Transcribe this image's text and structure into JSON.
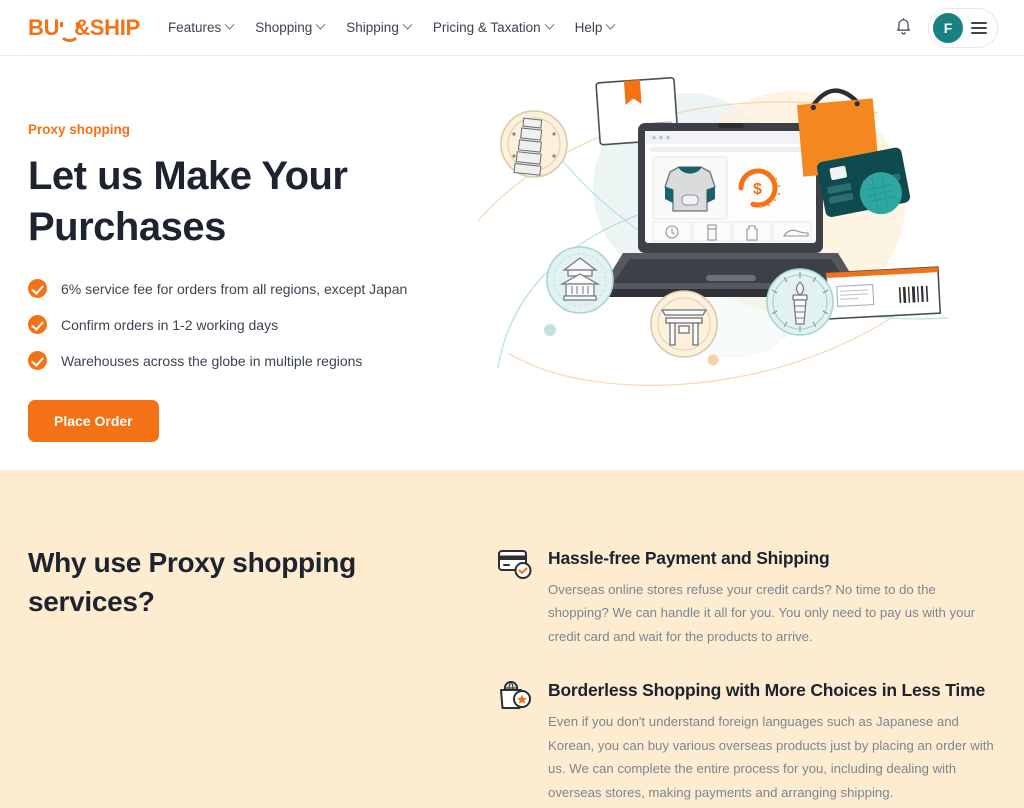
{
  "header": {
    "logo_text": "BUY&SHIP",
    "logo_part1": "BU",
    "logo_part2": "&SHIP",
    "nav": [
      {
        "label": "Features",
        "has_caret": true
      },
      {
        "label": "Shopping",
        "has_caret": true
      },
      {
        "label": "Shipping",
        "has_caret": true
      },
      {
        "label": "Pricing & Taxation",
        "has_caret": true
      },
      {
        "label": "Help",
        "has_caret": true
      }
    ],
    "notification_icon": "bell-icon",
    "avatar_initial": "F",
    "avatar_color": "#1a8181",
    "menu_icon": "hamburger-icon"
  },
  "hero": {
    "eyebrow": "Proxy shopping",
    "title": "Let us Make Your Purchases",
    "bullets": [
      "6% service fee for orders from all regions, except Japan",
      "Confirm orders in 1-2 working days",
      "Warehouses across the globe in multiple regions"
    ],
    "cta_label": "Place Order",
    "illustration": "proxy-shopping-illustration"
  },
  "why": {
    "title": "Why use Proxy shopping services?",
    "features": [
      {
        "icon": "credit-card-check-icon",
        "title": "Hassle-free Payment and Shipping",
        "body": "Overseas online stores refuse your credit cards? No time to do the shopping? We can handle it all for you. You only need to pay us with your credit card and wait for the products to arrive."
      },
      {
        "icon": "global-shopping-bag-icon",
        "title": "Borderless Shopping with More Choices in Less Time",
        "body": "Even if you don't understand foreign languages such as Japanese and Korean, you can buy various overseas products just by placing an order with us. We can complete the entire process for you, including dealing with overseas stores, making payments and arranging shipping."
      }
    ]
  },
  "colors": {
    "brand_orange": "#f47216",
    "cream_bg": "#fdeccf",
    "teal": "#1a8181",
    "heading": "#1d2430",
    "body_text": "#7d8593"
  }
}
